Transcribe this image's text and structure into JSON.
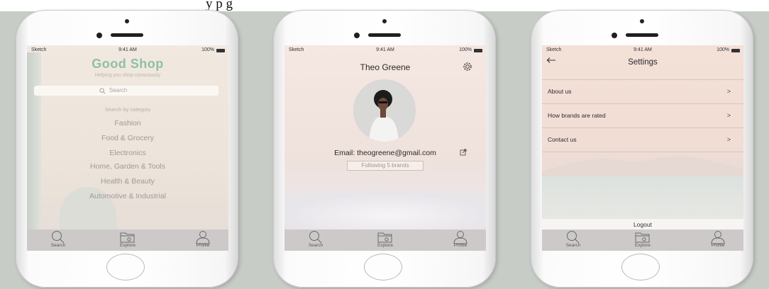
{
  "caption_fragment": "y                                                          p                              g",
  "status_bar": {
    "carrier": "Sketch",
    "time": "9:41 AM",
    "battery": "100%"
  },
  "tab_bar": {
    "search": "Search",
    "explore": "Explore",
    "profile": "Profile"
  },
  "explore_screen": {
    "app_title": "Good Shop",
    "tagline": "Helping you shop consciously",
    "search_placeholder": "Search",
    "category_heading": "Search by category",
    "categories": [
      "Fashion",
      "Food & Grocery",
      "Electronics",
      "Home, Garden & Tools",
      "Health & Beauty",
      "Automotive & Industrial"
    ]
  },
  "profile_screen": {
    "user_name": "Theo Greene",
    "email_line": "Email: theogreene@gmail.com",
    "following_button": "Following 5 brands"
  },
  "settings_screen": {
    "title": "Settings",
    "items": [
      {
        "label": "About us",
        "chevron": ">"
      },
      {
        "label": "How brands are rated",
        "chevron": ">"
      },
      {
        "label": "Contact us",
        "chevron": ">"
      }
    ],
    "logout": "Logout"
  }
}
